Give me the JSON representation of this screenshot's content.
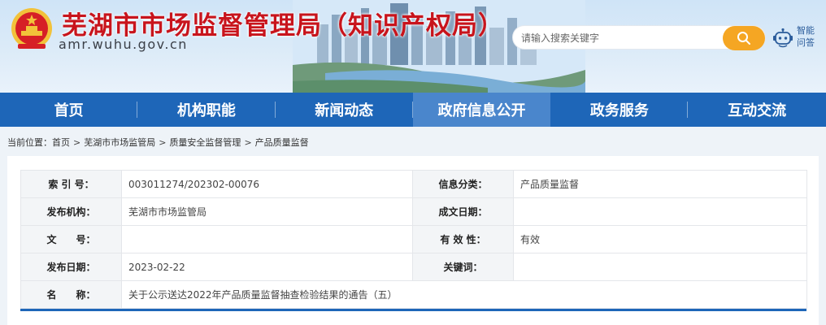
{
  "header": {
    "title": "芜湖市市场监督管理局（知识产权局）",
    "url": "amr.wuhu.gov.cn",
    "search_placeholder": "请输入搜索关键字",
    "assistant_label": "智能问答"
  },
  "nav": {
    "items": [
      {
        "label": "首页"
      },
      {
        "label": "机构职能"
      },
      {
        "label": "新闻动态"
      },
      {
        "label": "政府信息公开",
        "active": true
      },
      {
        "label": "政务服务"
      },
      {
        "label": "互动交流"
      }
    ]
  },
  "breadcrumb": {
    "prefix": "当前位置：",
    "items": [
      "首页",
      "芜湖市市场监管局",
      "质量安全监督管理",
      "产品质量监督"
    ],
    "separator": ">"
  },
  "info": {
    "index_label": "索 引 号：",
    "index_value": "003011274/202302-00076",
    "category_label": "信息分类：",
    "category_value": "产品质量监督",
    "publisher_label": "发布机构：",
    "publisher_value": "芜湖市市场监管局",
    "written_date_label": "成文日期：",
    "written_date_value": "",
    "doc_no_label": "文　　号：",
    "doc_no_value": "",
    "validity_label": "有 效 性：",
    "validity_value": "有效",
    "publish_date_label": "发布日期：",
    "publish_date_value": "2023-02-22",
    "keywords_label": "关键词：",
    "keywords_value": "",
    "name_label": "名　　称：",
    "name_value": "关于公示送达2022年产品质量监督抽查检验结果的通告（五）"
  },
  "colors": {
    "nav_bg": "#1e66b8",
    "nav_active": "#4a86cc",
    "title_red": "#c8141c",
    "search_button": "#f5a623"
  },
  "icons": {
    "emblem": "national-emblem-icon",
    "search": "search-icon",
    "assistant": "robot-icon"
  }
}
